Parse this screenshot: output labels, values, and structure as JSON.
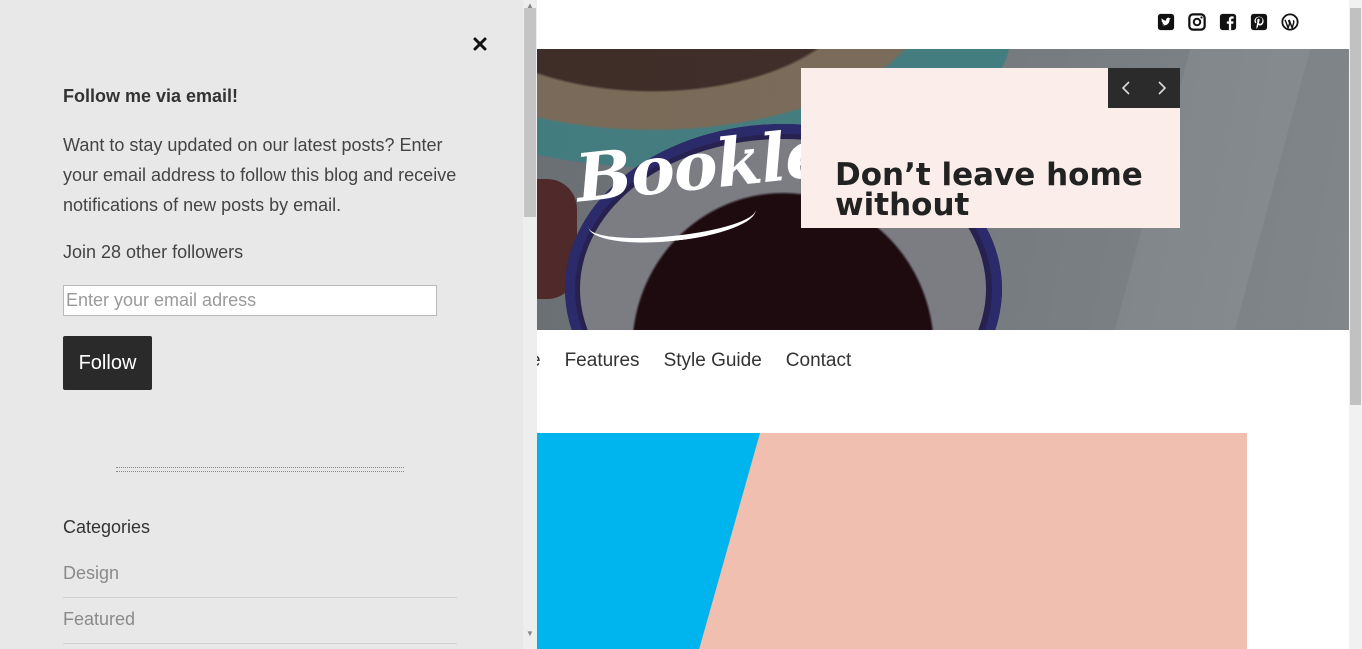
{
  "site": {
    "logo": "Booklet",
    "social_icons": [
      "twitter-icon",
      "instagram-icon",
      "facebook-icon",
      "pinterest-icon",
      "wordpress-icon"
    ]
  },
  "nav": {
    "items": [
      {
        "label": "e"
      },
      {
        "label": "Features"
      },
      {
        "label": "Style Guide"
      },
      {
        "label": "Contact"
      }
    ]
  },
  "slider": {
    "title": "Don’t leave home without"
  },
  "sidebar": {
    "widget_title": "Follow me via email!",
    "description": "Want to stay updated on our latest posts? Enter your email address to follow this blog and receive notifications of new posts by email.",
    "followers_text": "Join 28 other followers",
    "email_placeholder": "Enter your email adress",
    "follow_label": "Follow",
    "close_symbol": "✖",
    "categories_heading": "Categories",
    "categories": [
      {
        "label": "Design"
      },
      {
        "label": "Featured"
      }
    ]
  },
  "colors": {
    "sidebar_bg": "#e8e8e8",
    "button_bg": "#2a2a2a",
    "slider_blue": "#00b5ee",
    "slider_peach": "#f0bfb0"
  }
}
